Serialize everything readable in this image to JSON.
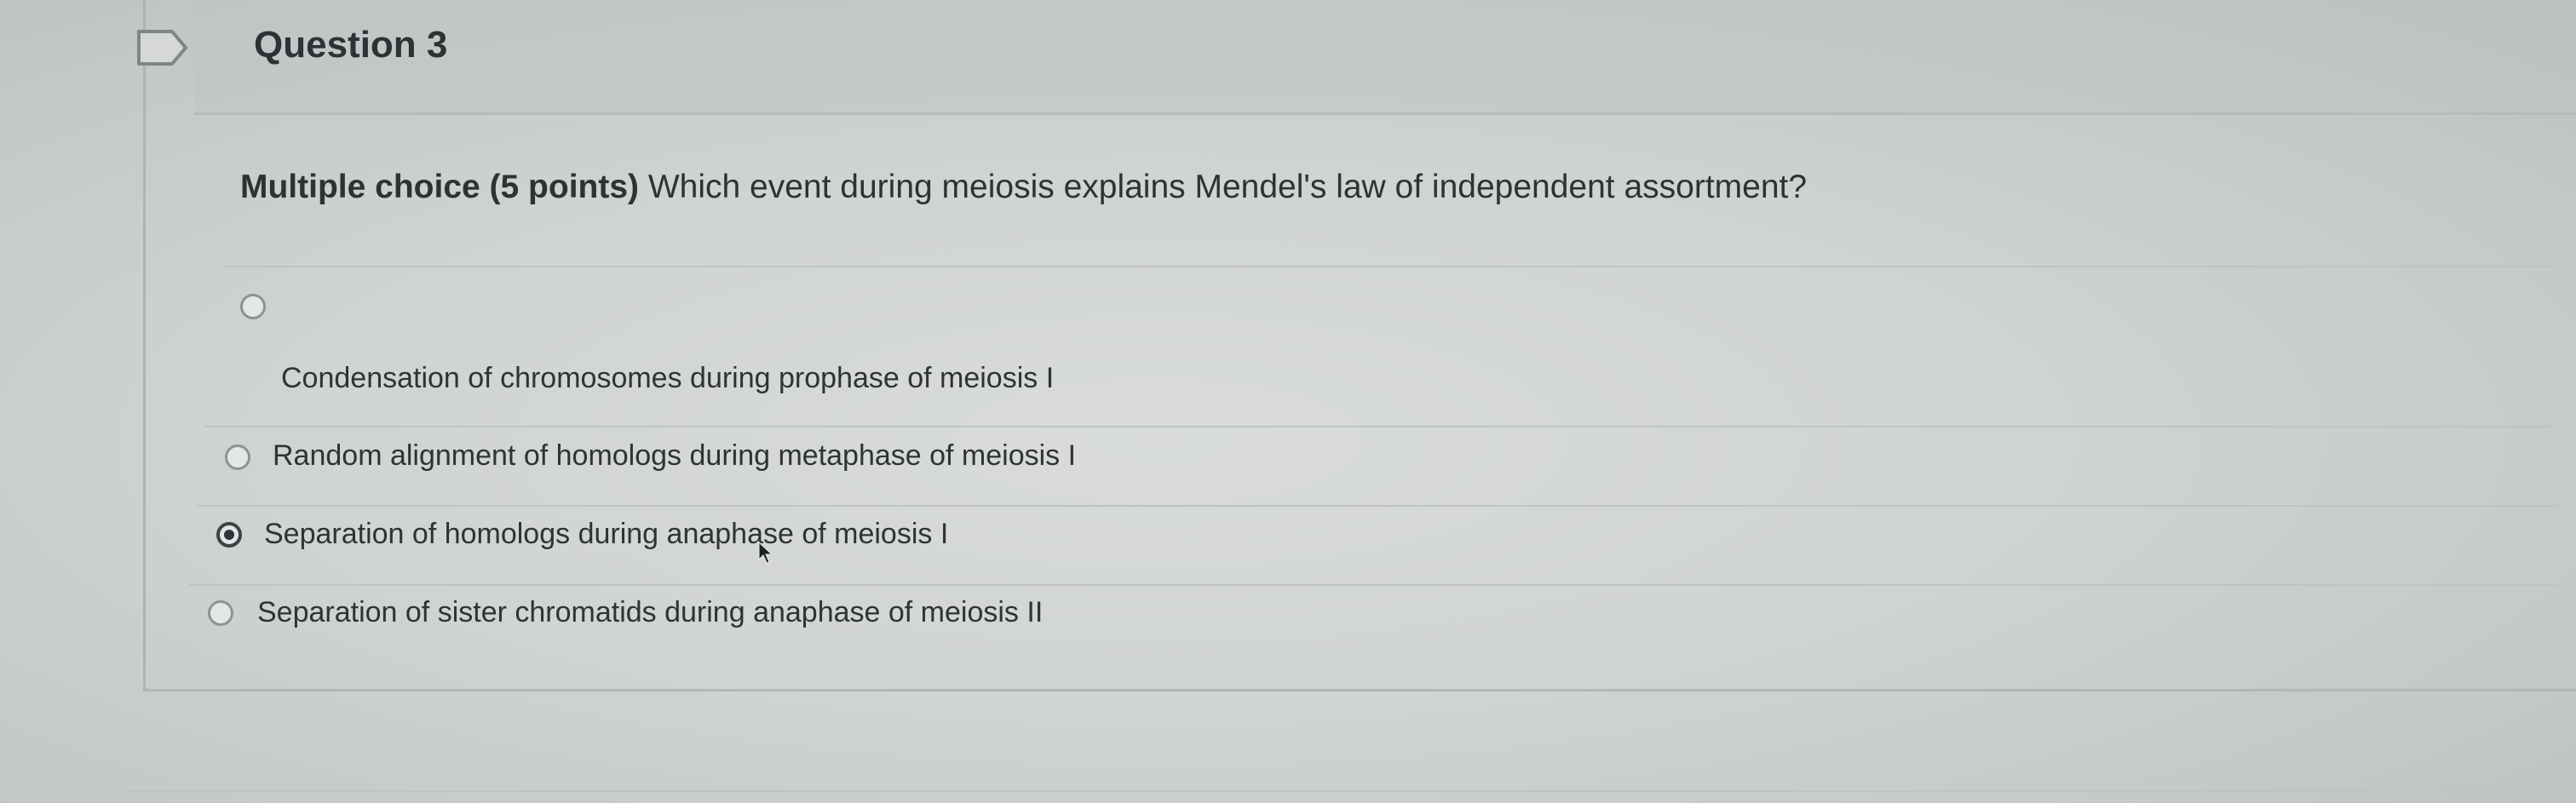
{
  "question": {
    "title": "Question 3",
    "type_label": "Multiple choice (5 points)",
    "prompt": " Which event during meiosis explains Mendel's law of independent assortment?",
    "selected_index": 2,
    "choices": [
      {
        "label": "Condensation of chromosomes during prophase of meiosis I",
        "selected": false
      },
      {
        "label": "Random alignment of homologs during metaphase of meiosis I",
        "selected": false
      },
      {
        "label": "Separation of homologs during anaphase of meiosis I",
        "selected": true
      },
      {
        "label": "Separation of sister chromatids during anaphase of meiosis II",
        "selected": false
      }
    ]
  },
  "icons": {
    "flag": "flag-icon",
    "cursor": "mouse-cursor-icon"
  },
  "colors": {
    "background": "#cfd3d1",
    "text": "#2f3234",
    "radio_border": "#8d9395",
    "radio_selected": "#2e3539"
  }
}
